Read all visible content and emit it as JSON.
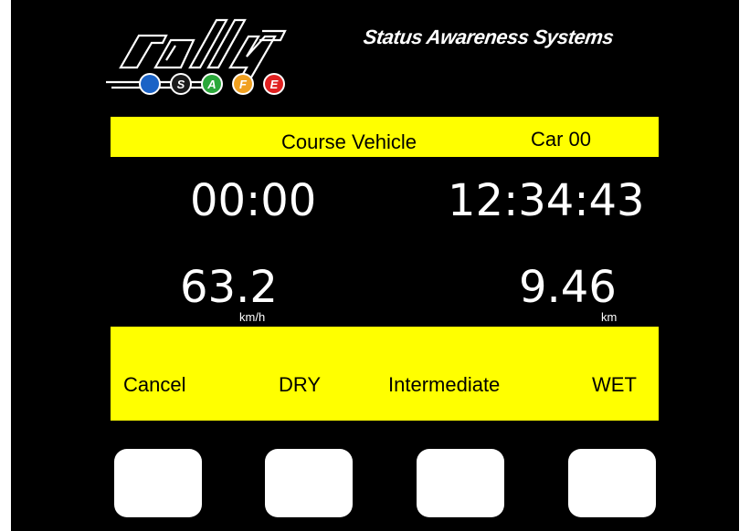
{
  "header": {
    "logo_text": "rally",
    "logo_letters": [
      "S",
      "A",
      "F",
      "E"
    ],
    "logo_colors": [
      "#1b63c6",
      "#1a1a1a",
      "#2aa83a",
      "#f0a020",
      "#e02020"
    ],
    "tagline": "Status Awareness Systems"
  },
  "banner": {
    "title": "Course Vehicle",
    "car": "Car  00",
    "color": "#ffff00"
  },
  "readouts": {
    "elapsed": "00:00",
    "clock": "12:34:43",
    "speed": "63.2",
    "speed_unit": "km/h",
    "distance": "9.46",
    "distance_unit": "km"
  },
  "options": {
    "cancel": "Cancel",
    "dry": "DRY",
    "intermediate": "Intermediate",
    "wet": "WET"
  },
  "hardware_buttons": [
    "button-1",
    "button-2",
    "button-3",
    "button-4"
  ]
}
